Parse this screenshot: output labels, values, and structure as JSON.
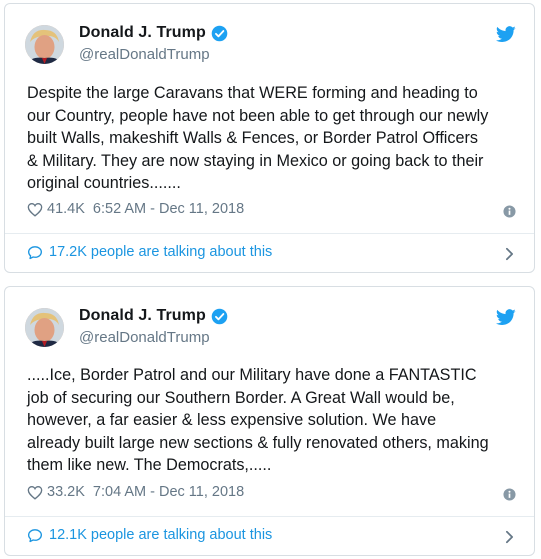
{
  "colors": {
    "accent": "#1da1f2",
    "link": "#1b95e0",
    "muted": "#657786",
    "text": "#14171a",
    "border": "#d8dee3"
  },
  "tweets": [
    {
      "author": {
        "name": "Donald J. Trump",
        "handle": "@realDonaldTrump"
      },
      "text": "Despite the large Caravans that WERE forming and heading to\nour Country, people have not been able to get through our newly\nbuilt Walls, makeshift Walls & Fences, or Border Patrol Officers\n& Military. They are now staying in Mexico or going back to their\noriginal countries.......",
      "likes": "41.4K",
      "timestamp": "6:52 AM - Dec 11, 2018",
      "talking": "17.2K people are talking about this"
    },
    {
      "author": {
        "name": "Donald J. Trump",
        "handle": "@realDonaldTrump"
      },
      "text": ".....Ice, Border Patrol and our Military have done a FANTASTIC\njob of securing our Southern Border. A Great Wall would be,\nhowever, a far easier & less expensive solution. We have\nalready built large new sections & fully renovated others, making\nthem like new. The Democrats,.....",
      "likes": "33.2K",
      "timestamp": "7:04 AM - Dec 11, 2018",
      "talking": "12.1K people are talking about this"
    }
  ]
}
